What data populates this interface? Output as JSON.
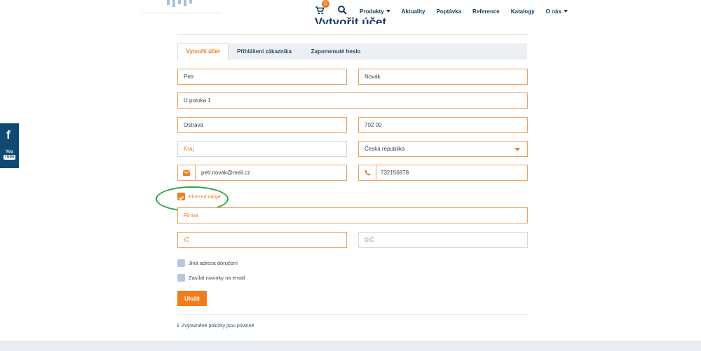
{
  "header": {
    "cart_count": "0",
    "nav": [
      {
        "label": "Produkty",
        "has_dropdown": true
      },
      {
        "label": "Aktuality",
        "has_dropdown": false
      },
      {
        "label": "Poptávka",
        "has_dropdown": false
      },
      {
        "label": "Reference",
        "has_dropdown": false
      },
      {
        "label": "Katalogy",
        "has_dropdown": false
      },
      {
        "label": "O nás",
        "has_dropdown": true
      }
    ]
  },
  "page": {
    "title": "Vytvořit účet"
  },
  "tabs": [
    {
      "label": "Vytvořit účet",
      "active": true
    },
    {
      "label": "Přihlášení zákazníka",
      "active": false
    },
    {
      "label": "Zapomenuté heslo",
      "active": false
    }
  ],
  "form": {
    "first_name": "Petr",
    "last_name": "Novák",
    "street": "U potoka 1",
    "city": "Ostrava",
    "zip": "702 00",
    "region_placeholder": "Kraj",
    "country": "Česká republika",
    "email": "petr.novak@meil.cz",
    "phone": "732156878",
    "company_checkbox": {
      "label": "Firemní údaje",
      "checked": true
    },
    "company_placeholder": "Firma",
    "ic_placeholder": "IČ",
    "dic_placeholder": "DIČ",
    "other_address": {
      "label": "Jiná adresa doručení",
      "checked": false
    },
    "newsletter": {
      "label": "Zasílat novinky na email",
      "checked": false
    },
    "save_label": "Uložit"
  },
  "info": {
    "icon": "i",
    "text": "Zvýrazněné položky jsou povinné"
  },
  "social": {
    "facebook": "f",
    "youtube_top": "You",
    "youtube_bottom": "Tube"
  },
  "colors": {
    "accent": "#f07c1b",
    "navy": "#1a3d60",
    "social_bg": "#0f4a74",
    "annotation": "#2ea34a"
  }
}
